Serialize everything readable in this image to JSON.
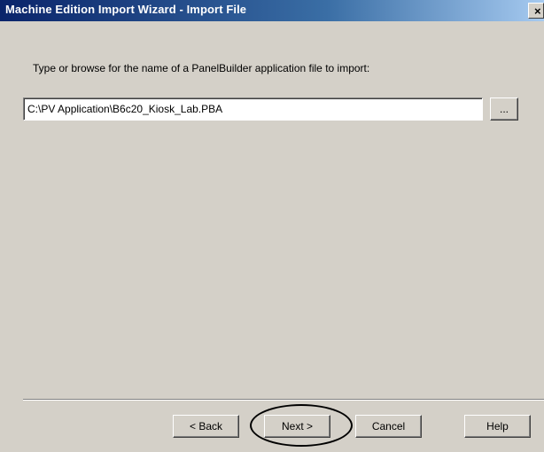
{
  "window": {
    "title": "Machine Edition Import Wizard - Import File",
    "close_glyph": "×"
  },
  "content": {
    "instruction": "Type or browse for the name of a PanelBuilder application file to import:",
    "file_path_value": "C:\\PV Application\\B6c20_Kiosk_Lab.PBA",
    "browse_label": "..."
  },
  "buttons": {
    "back": "< Back",
    "next": "Next >",
    "cancel": "Cancel",
    "help": "Help"
  },
  "icons": {
    "close": "close-icon"
  },
  "colors": {
    "titlebar_start": "#0a246a",
    "titlebar_end": "#a6caf0",
    "dialog_bg": "#d4d0c8"
  }
}
